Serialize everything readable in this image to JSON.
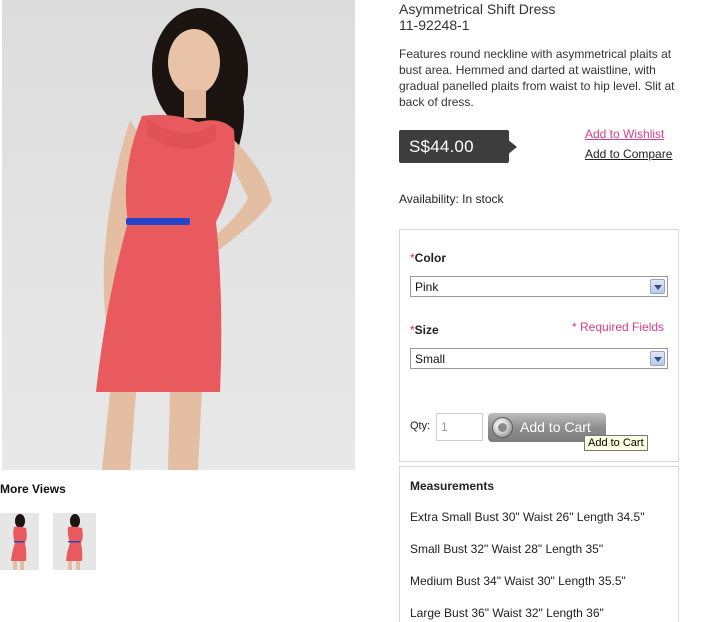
{
  "product": {
    "name": "Asymmetrical Shift Dress",
    "sku": "11-92248-1",
    "description": "Features round neckline with asymmetrical plaits at bust area. Hemmed and darted at waistline, with gradual panelled plaits from waist to hip level. Slit at back of dress.",
    "price": "S$44.00",
    "availability_label": "Availability:",
    "availability_value": "In stock"
  },
  "links": {
    "wishlist": "Add to Wishlist",
    "compare": "Add to Compare"
  },
  "gallery": {
    "more_views_label": "More Views",
    "thumbnails": [
      "front-view",
      "back-view"
    ]
  },
  "options": {
    "required_marker": "*",
    "color_label": "Color",
    "color_selected": "Pink",
    "size_label": "Size",
    "size_selected": "Small",
    "required_note": "* Required Fields"
  },
  "cart": {
    "qty_label": "Qty:",
    "qty_value": "1",
    "button_label": "Add to Cart",
    "tooltip": "Add to Cart"
  },
  "measurements": {
    "title": "Measurements",
    "rows": [
      "Extra Small Bust 30\" Waist 26\" Length 34.5\"",
      "Small Bust 32\" Waist 28\" Length 35\"",
      "Medium Bust 34\" Waist 30\" Length 35.5\"",
      "Large Bust 36\" Waist 32\" Length 36\""
    ]
  },
  "colors": {
    "accent_pink": "#d6407e",
    "price_tag_bg": "#3d3d3d",
    "dress": "#e85a5e",
    "belt": "#2346c8"
  }
}
